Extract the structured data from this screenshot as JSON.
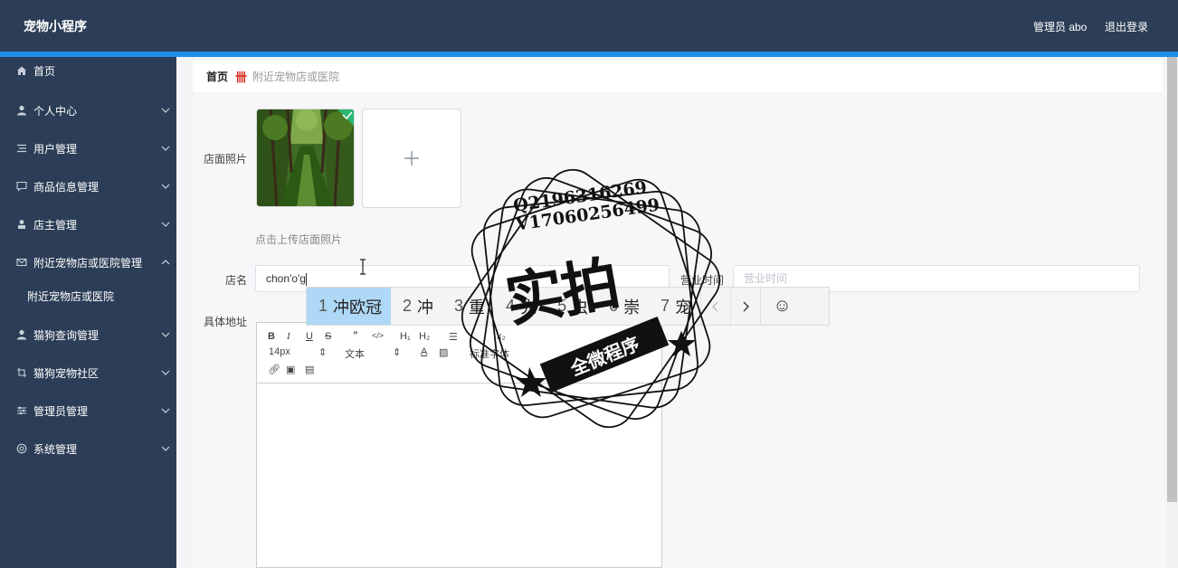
{
  "header": {
    "app_title": "宠物小程序",
    "admin_label": "管理员 abo",
    "logout_label": "退出登录"
  },
  "sidebar": {
    "items": [
      {
        "label": "首页",
        "icon": "home-icon"
      },
      {
        "label": "个人中心",
        "icon": "user-icon"
      },
      {
        "label": "用户管理",
        "icon": "list-icon"
      },
      {
        "label": "商品信息管理",
        "icon": "chat-icon"
      },
      {
        "label": "店主管理",
        "icon": "person-icon"
      },
      {
        "label": "附近宠物店或医院管理",
        "icon": "mail-icon"
      },
      {
        "label": "猫狗查询管理",
        "icon": "user-icon"
      },
      {
        "label": "猫狗宠物社区",
        "icon": "crop-icon"
      },
      {
        "label": "管理员管理",
        "icon": "sliders-icon"
      },
      {
        "label": "系统管理",
        "icon": "gear-icon"
      }
    ],
    "subitem": "附近宠物店或医院"
  },
  "breadcrumb": {
    "home": "首页",
    "current": "附近宠物店或医院"
  },
  "form": {
    "photo_label": "店面照片",
    "upload_hint": "点击上传店面照片",
    "name_label": "店名",
    "name_value": "chon'o'g",
    "hours_label": "营业时间",
    "hours_placeholder": "营业时间",
    "address_label": "具体地址"
  },
  "editor": {
    "font_size": "14px",
    "paragraph": "文本",
    "font_family": "标准字体"
  },
  "ime": {
    "candidates": [
      {
        "num": "1",
        "text": "冲欧冠"
      },
      {
        "num": "2",
        "text": "冲"
      },
      {
        "num": "3",
        "text": "重"
      },
      {
        "num": "4",
        "text": "充"
      },
      {
        "num": "5",
        "text": "虫"
      },
      {
        "num": "6",
        "text": "崇"
      },
      {
        "num": "7",
        "text": "宠"
      }
    ]
  },
  "watermark": {
    "line1": "Q2196316269",
    "line2": "V17060256499",
    "big": "实拍",
    "ribbon": "全微程序"
  }
}
